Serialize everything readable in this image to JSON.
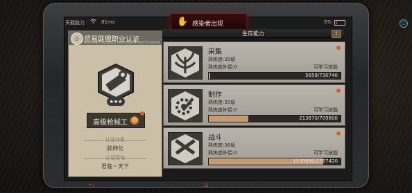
{
  "status": {
    "carrier": "天龍能力",
    "wifi_icon": "wifi-icon",
    "time": "81ms",
    "battery": "5%"
  },
  "alert": {
    "text": "感染者出现",
    "icon": "infected-hand-icon",
    "color": "#e22222"
  },
  "certificate": {
    "title": "贸易联盟职业认证",
    "subtitle": "MERCHANT ALLIANCE PROFESSION CERTIFICATION",
    "stars": "★★★",
    "rank": "高级枪械工",
    "target_label": "认证对象",
    "target_value": "就神化",
    "place_label": "认证营地",
    "place_value": "君临・天下"
  },
  "skills_header": "生存能力",
  "skills": [
    {
      "name": "采集",
      "icon": "gather-plant-icon",
      "level": "熟练度:35级",
      "compensation": "熟练度补偿:0",
      "learn": "可学习技能",
      "progress": "5658/730740",
      "fraction": 0.008
    },
    {
      "name": "制作",
      "icon": "craft-gear-wrench-icon",
      "level": "熟练度:35级",
      "compensation": "熟练度补偿:0",
      "learn": "可学习技能",
      "progress": "213670/709800",
      "fraction": 0.301
    },
    {
      "name": "战斗",
      "icon": "combat-guns-icon",
      "level": "熟练度:36级",
      "compensation": "熟练度补偿:0",
      "learn": "可学习技能",
      "progress": "1539850/1767420",
      "fraction": 0.871
    }
  ],
  "colors": {
    "accent": "#e05a26",
    "bar_fill": "#c79a72"
  }
}
